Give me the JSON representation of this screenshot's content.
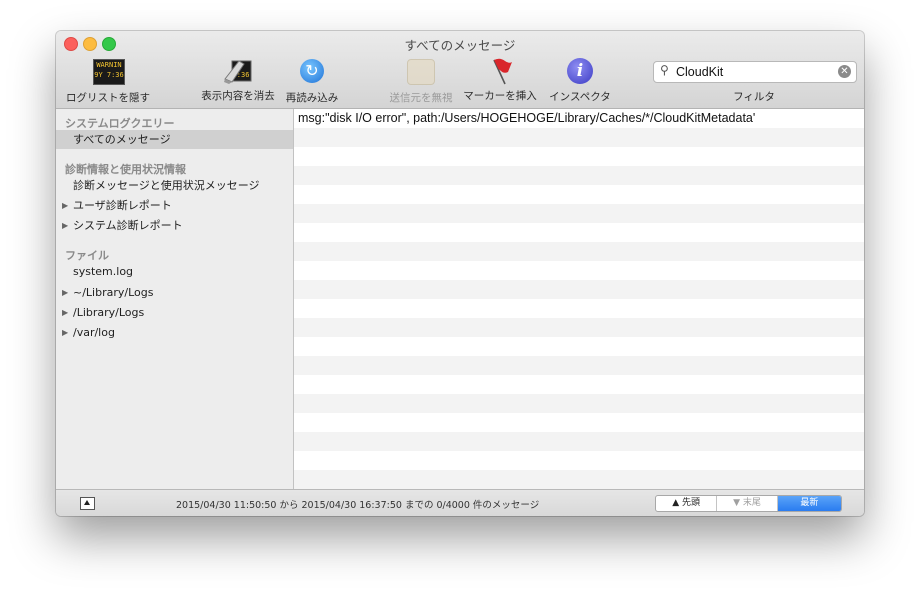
{
  "window": {
    "title": "すべてのメッセージ"
  },
  "toolbar": {
    "items": [
      {
        "label": "ログリストを隠す",
        "icon": "console-icon",
        "enabled": true
      },
      {
        "label": "表示内容を消去",
        "icon": "clear-display-icon",
        "enabled": true
      },
      {
        "label": "再読み込み",
        "icon": "reload-icon",
        "enabled": true
      },
      {
        "label": "送信元を無視",
        "icon": "ignore-sender-icon",
        "enabled": false
      },
      {
        "label": "マーカーを挿入",
        "icon": "marker-flag-icon",
        "enabled": true
      },
      {
        "label": "インスペクタ",
        "icon": "info-icon",
        "enabled": true
      }
    ],
    "console_icon_text": [
      "WARNIN",
      "9Y 7:36"
    ],
    "clear_icon_text": "7:36",
    "search": {
      "value": "CloudKit",
      "placeholder": ""
    },
    "filter_label": "フィルタ"
  },
  "sidebar": {
    "groups": [
      {
        "header": "システムログクエリー",
        "items": [
          {
            "label": "すべてのメッセージ",
            "selected": true,
            "expandable": false
          }
        ]
      },
      {
        "header": "診断情報と使用状況情報",
        "items": [
          {
            "label": "診断メッセージと使用状況メッセージ",
            "selected": false,
            "expandable": false
          },
          {
            "label": "ユーザ診断レポート",
            "selected": false,
            "expandable": true
          },
          {
            "label": "システム診断レポート",
            "selected": false,
            "expandable": true
          }
        ]
      },
      {
        "header": "ファイル",
        "items": [
          {
            "label": "system.log",
            "selected": false,
            "expandable": false
          },
          {
            "label": "~/Library/Logs",
            "selected": false,
            "expandable": true
          },
          {
            "label": "/Library/Logs",
            "selected": false,
            "expandable": true
          },
          {
            "label": "/var/log",
            "selected": false,
            "expandable": true
          }
        ]
      }
    ]
  },
  "log": {
    "rows": [
      "msg:\"disk I/O error\", path:/Users/HOGEHOGE/Library/Caches/*/CloudKitMetadata'"
    ]
  },
  "status": {
    "text": "2015/04/30 11:50:50 から 2015/04/30 16:37:50 までの 0/4000 件のメッセージ",
    "nav": {
      "first": "▲ 先頭",
      "last": "▼ 末尾",
      "latest": "最新"
    }
  }
}
